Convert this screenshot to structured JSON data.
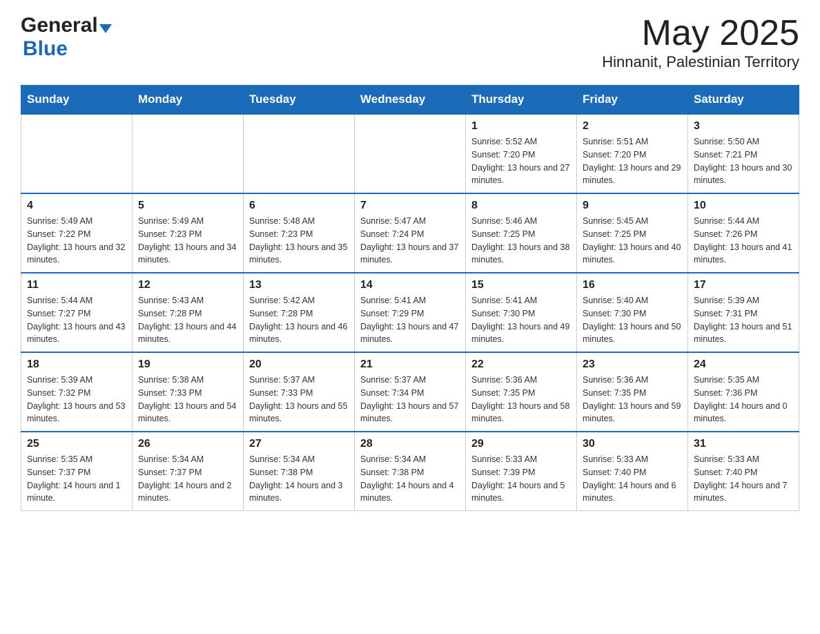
{
  "header": {
    "logo_general": "General",
    "logo_blue": "Blue",
    "month": "May 2025",
    "location": "Hinnanit, Palestinian Territory"
  },
  "weekdays": [
    "Sunday",
    "Monday",
    "Tuesday",
    "Wednesday",
    "Thursday",
    "Friday",
    "Saturday"
  ],
  "weeks": [
    [
      {
        "day": "",
        "info": ""
      },
      {
        "day": "",
        "info": ""
      },
      {
        "day": "",
        "info": ""
      },
      {
        "day": "",
        "info": ""
      },
      {
        "day": "1",
        "info": "Sunrise: 5:52 AM\nSunset: 7:20 PM\nDaylight: 13 hours and 27 minutes."
      },
      {
        "day": "2",
        "info": "Sunrise: 5:51 AM\nSunset: 7:20 PM\nDaylight: 13 hours and 29 minutes."
      },
      {
        "day": "3",
        "info": "Sunrise: 5:50 AM\nSunset: 7:21 PM\nDaylight: 13 hours and 30 minutes."
      }
    ],
    [
      {
        "day": "4",
        "info": "Sunrise: 5:49 AM\nSunset: 7:22 PM\nDaylight: 13 hours and 32 minutes."
      },
      {
        "day": "5",
        "info": "Sunrise: 5:49 AM\nSunset: 7:23 PM\nDaylight: 13 hours and 34 minutes."
      },
      {
        "day": "6",
        "info": "Sunrise: 5:48 AM\nSunset: 7:23 PM\nDaylight: 13 hours and 35 minutes."
      },
      {
        "day": "7",
        "info": "Sunrise: 5:47 AM\nSunset: 7:24 PM\nDaylight: 13 hours and 37 minutes."
      },
      {
        "day": "8",
        "info": "Sunrise: 5:46 AM\nSunset: 7:25 PM\nDaylight: 13 hours and 38 minutes."
      },
      {
        "day": "9",
        "info": "Sunrise: 5:45 AM\nSunset: 7:25 PM\nDaylight: 13 hours and 40 minutes."
      },
      {
        "day": "10",
        "info": "Sunrise: 5:44 AM\nSunset: 7:26 PM\nDaylight: 13 hours and 41 minutes."
      }
    ],
    [
      {
        "day": "11",
        "info": "Sunrise: 5:44 AM\nSunset: 7:27 PM\nDaylight: 13 hours and 43 minutes."
      },
      {
        "day": "12",
        "info": "Sunrise: 5:43 AM\nSunset: 7:28 PM\nDaylight: 13 hours and 44 minutes."
      },
      {
        "day": "13",
        "info": "Sunrise: 5:42 AM\nSunset: 7:28 PM\nDaylight: 13 hours and 46 minutes."
      },
      {
        "day": "14",
        "info": "Sunrise: 5:41 AM\nSunset: 7:29 PM\nDaylight: 13 hours and 47 minutes."
      },
      {
        "day": "15",
        "info": "Sunrise: 5:41 AM\nSunset: 7:30 PM\nDaylight: 13 hours and 49 minutes."
      },
      {
        "day": "16",
        "info": "Sunrise: 5:40 AM\nSunset: 7:30 PM\nDaylight: 13 hours and 50 minutes."
      },
      {
        "day": "17",
        "info": "Sunrise: 5:39 AM\nSunset: 7:31 PM\nDaylight: 13 hours and 51 minutes."
      }
    ],
    [
      {
        "day": "18",
        "info": "Sunrise: 5:39 AM\nSunset: 7:32 PM\nDaylight: 13 hours and 53 minutes."
      },
      {
        "day": "19",
        "info": "Sunrise: 5:38 AM\nSunset: 7:33 PM\nDaylight: 13 hours and 54 minutes."
      },
      {
        "day": "20",
        "info": "Sunrise: 5:37 AM\nSunset: 7:33 PM\nDaylight: 13 hours and 55 minutes."
      },
      {
        "day": "21",
        "info": "Sunrise: 5:37 AM\nSunset: 7:34 PM\nDaylight: 13 hours and 57 minutes."
      },
      {
        "day": "22",
        "info": "Sunrise: 5:36 AM\nSunset: 7:35 PM\nDaylight: 13 hours and 58 minutes."
      },
      {
        "day": "23",
        "info": "Sunrise: 5:36 AM\nSunset: 7:35 PM\nDaylight: 13 hours and 59 minutes."
      },
      {
        "day": "24",
        "info": "Sunrise: 5:35 AM\nSunset: 7:36 PM\nDaylight: 14 hours and 0 minutes."
      }
    ],
    [
      {
        "day": "25",
        "info": "Sunrise: 5:35 AM\nSunset: 7:37 PM\nDaylight: 14 hours and 1 minute."
      },
      {
        "day": "26",
        "info": "Sunrise: 5:34 AM\nSunset: 7:37 PM\nDaylight: 14 hours and 2 minutes."
      },
      {
        "day": "27",
        "info": "Sunrise: 5:34 AM\nSunset: 7:38 PM\nDaylight: 14 hours and 3 minutes."
      },
      {
        "day": "28",
        "info": "Sunrise: 5:34 AM\nSunset: 7:38 PM\nDaylight: 14 hours and 4 minutes."
      },
      {
        "day": "29",
        "info": "Sunrise: 5:33 AM\nSunset: 7:39 PM\nDaylight: 14 hours and 5 minutes."
      },
      {
        "day": "30",
        "info": "Sunrise: 5:33 AM\nSunset: 7:40 PM\nDaylight: 14 hours and 6 minutes."
      },
      {
        "day": "31",
        "info": "Sunrise: 5:33 AM\nSunset: 7:40 PM\nDaylight: 14 hours and 7 minutes."
      }
    ]
  ]
}
